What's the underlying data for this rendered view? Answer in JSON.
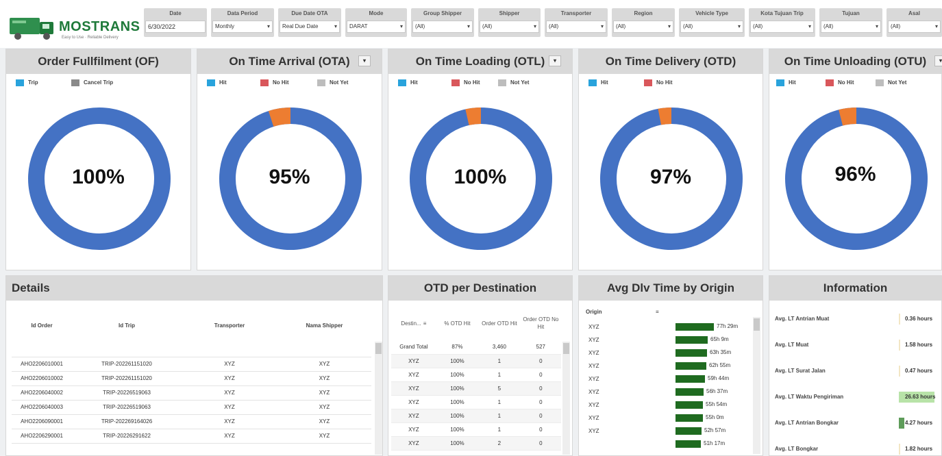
{
  "brand": {
    "name": "MOSTRANS",
    "tagline": "Easy to Use · Reliable Delivery"
  },
  "filters": [
    {
      "label": "Date",
      "value": "6/30/2022",
      "type": "input"
    },
    {
      "label": "Data Period",
      "value": "Monthly",
      "type": "select"
    },
    {
      "label": "Due Date OTA",
      "value": "Real Due Date",
      "type": "select"
    },
    {
      "label": "Mode",
      "value": "DARAT",
      "type": "select"
    },
    {
      "label": "Group Shipper",
      "value": "(All)",
      "type": "select"
    },
    {
      "label": "Shipper",
      "value": "(All)",
      "type": "select"
    },
    {
      "label": "Transporter",
      "value": "(All)",
      "type": "select"
    },
    {
      "label": "Region",
      "value": "(All)",
      "type": "select"
    },
    {
      "label": "Vehicle Type",
      "value": "(All)",
      "type": "select"
    },
    {
      "label": "Kota Tujuan Trip",
      "value": "(All)",
      "type": "select"
    },
    {
      "label": "Tujuan",
      "value": "(All)",
      "type": "select"
    },
    {
      "label": "Asal",
      "value": "(All)",
      "type": "select"
    }
  ],
  "kpis": [
    {
      "title": "Order Fullfilment (OF)",
      "value_label": "100%",
      "share": 1.0,
      "dropdown": false,
      "legend": [
        {
          "label": "Trip",
          "color": "#29a3dc"
        },
        {
          "label": "Cancel Trip",
          "color": "#8a8a8a"
        }
      ]
    },
    {
      "title": "On Time Arrival (OTA)",
      "value_label": "95%",
      "share": 0.95,
      "dropdown": true,
      "legend": [
        {
          "label": "Hit",
          "color": "#29a3dc"
        },
        {
          "label": "No Hit",
          "color": "#d9575b"
        },
        {
          "label": "Not Yet",
          "color": "#bdbdbd"
        }
      ]
    },
    {
      "title": "On Time Loading (OTL)",
      "value_label": "100%",
      "share": 0.965,
      "dropdown": true,
      "legend": [
        {
          "label": "Hit",
          "color": "#29a3dc"
        },
        {
          "label": "No Hit",
          "color": "#d9575b"
        },
        {
          "label": "Not Yet",
          "color": "#bdbdbd"
        }
      ]
    },
    {
      "title": "On Time Delivery (OTD)",
      "value_label": "97%",
      "share": 0.97,
      "dropdown": false,
      "legend": [
        {
          "label": "Hit",
          "color": "#29a3dc"
        },
        {
          "label": "No Hit",
          "color": "#d9575b"
        }
      ]
    },
    {
      "title": "On Time Unloading (OTU)",
      "value_label": "96%",
      "share": 0.96,
      "dropdown": true,
      "legend": [
        {
          "label": "Hit",
          "color": "#29a3dc"
        },
        {
          "label": "No Hit",
          "color": "#d9575b"
        },
        {
          "label": "Not Yet",
          "color": "#bdbdbd"
        }
      ]
    }
  ],
  "colors": {
    "ring_main": "#4472c4",
    "ring_rest": "#ed7d31",
    "origin_bar": "#1f6b20"
  },
  "details": {
    "title": "Details",
    "columns": [
      "Id Order",
      "Id Trip",
      "Transporter",
      "Nama Shipper"
    ],
    "rows": [
      [
        "AHO2206010001",
        "TRIP-202261151020",
        "XYZ",
        "XYZ"
      ],
      [
        "AHO2206010002",
        "TRIP-202261151020",
        "XYZ",
        "XYZ"
      ],
      [
        "AHO2206040002",
        "TRIP-20226519063",
        "XYZ",
        "XYZ"
      ],
      [
        "AHO2206040003",
        "TRIP-20226519063",
        "XYZ",
        "XYZ"
      ],
      [
        "AHO2206090001",
        "TRIP-202269164026",
        "XYZ",
        "XYZ"
      ],
      [
        "AHO2206290001",
        "TRIP-20226291622",
        "XYZ",
        "XYZ"
      ]
    ]
  },
  "otd_dest": {
    "title": "OTD per Destination",
    "columns": [
      "Destin...",
      "% OTD Hit",
      "Order OTD Hit",
      "Order OTD No Hit"
    ],
    "rows": [
      [
        "Grand Total",
        "87%",
        "3,460",
        "527"
      ],
      [
        "XYZ",
        "100%",
        "1",
        "0"
      ],
      [
        "XYZ",
        "100%",
        "1",
        "0"
      ],
      [
        "XYZ",
        "100%",
        "5",
        "0"
      ],
      [
        "XYZ",
        "100%",
        "1",
        "0"
      ],
      [
        "XYZ",
        "100%",
        "1",
        "0"
      ],
      [
        "XYZ",
        "100%",
        "1",
        "0"
      ],
      [
        "XYZ",
        "100%",
        "2",
        "0"
      ]
    ]
  },
  "origin": {
    "title": "Avg Dlv Time by Origin",
    "column": "Origin",
    "rows": [
      {
        "name": "XYZ",
        "label": "77h 29m",
        "hours": 77.48
      },
      {
        "name": "XYZ",
        "label": "65h 9m",
        "hours": 65.15
      },
      {
        "name": "XYZ",
        "label": "63h 35m",
        "hours": 63.58
      },
      {
        "name": "XYZ",
        "label": "62h 55m",
        "hours": 62.92
      },
      {
        "name": "XYZ",
        "label": "59h 44m",
        "hours": 59.73
      },
      {
        "name": "XYZ",
        "label": "56h 37m",
        "hours": 56.62
      },
      {
        "name": "XYZ",
        "label": "55h 54m",
        "hours": 55.9
      },
      {
        "name": "XYZ",
        "label": "55h 0m",
        "hours": 55.0
      },
      {
        "name": "XYZ",
        "label": "52h 57m",
        "hours": 52.95
      },
      {
        "name": "",
        "label": "51h 17m",
        "hours": 51.28
      }
    ]
  },
  "information": {
    "title": "Information",
    "rows": [
      {
        "name": "Avg. LT Antrian Muat",
        "value": "0.36 hours",
        "bar_color": "#f3e6c4",
        "bar_frac": 0.03
      },
      {
        "name": "Avg. LT Muat",
        "value": "1.58 hours",
        "bar_color": "#f3e6c4",
        "bar_frac": 0.03
      },
      {
        "name": "Avg. LT Surat Jalan",
        "value": "0.47 hours",
        "bar_color": "#f3e6c4",
        "bar_frac": 0.03
      },
      {
        "name": "Avg. LT Waktu Pengiriman",
        "value": "26.63 hours",
        "bar_color": "#b8e3a8",
        "bar_frac": 1.0
      },
      {
        "name": "Avg. LT Antrian Bongkar",
        "value": "4.27 hours",
        "bar_color": "#5e9c5a",
        "bar_frac": 0.16
      },
      {
        "name": "Avg. LT Bongkar",
        "value": "1.82 hours",
        "bar_color": "#f3e6c4",
        "bar_frac": 0.03
      }
    ]
  }
}
